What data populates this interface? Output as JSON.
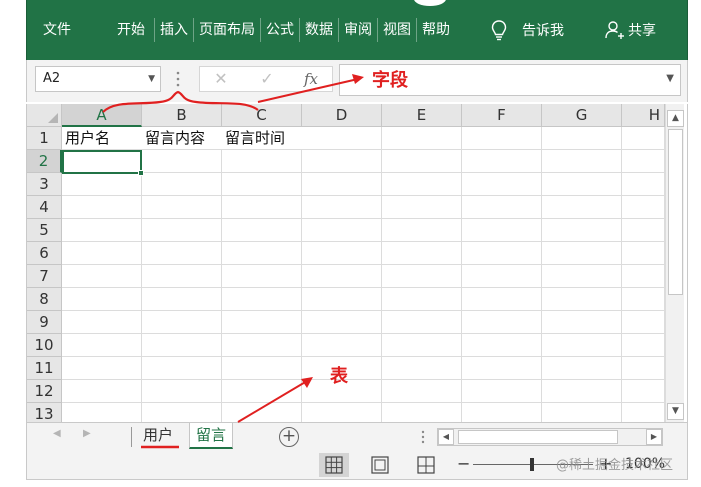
{
  "ribbon": {
    "tabs": [
      "文件",
      "开始",
      "插入",
      "页面布局",
      "公式",
      "数据",
      "审阅",
      "视图",
      "帮助"
    ],
    "tell_me": "告诉我",
    "share": "共享",
    "colors": {
      "ribbon_bg": "#217346",
      "text": "#ffffff"
    },
    "icons": {
      "tell_me": "lightbulb-icon",
      "share": "person-icon"
    }
  },
  "formula_bar": {
    "name_box": "A2",
    "formula_value": "",
    "cancel_glyph": "✕",
    "enter_glyph": "✓",
    "insert_function_glyph": "fx"
  },
  "grid": {
    "columns": [
      "A",
      "B",
      "C",
      "D",
      "E",
      "F",
      "G",
      "H"
    ],
    "rows": [
      "1",
      "2",
      "3",
      "4",
      "5",
      "6",
      "7",
      "8",
      "9",
      "10",
      "11",
      "12",
      "13"
    ],
    "active_column": "A",
    "active_row": "2",
    "header_row": [
      "用户名",
      "留言内容",
      "留言时间"
    ],
    "selection": "A2"
  },
  "sheets": {
    "tabs": [
      "用户",
      "留言"
    ],
    "active": "留言"
  },
  "status": {
    "zoom": "100%",
    "watermark": "@稀土掘金技术社区"
  },
  "annotations": {
    "field_label": "字段",
    "table_label": "表",
    "color": "#e02020"
  }
}
